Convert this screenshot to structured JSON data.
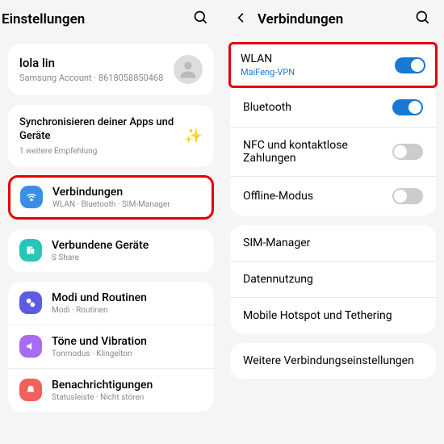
{
  "left": {
    "title": "Einstellungen",
    "profile": {
      "name": "lola lin",
      "sub": "Samsung Account · 8618058850468"
    },
    "sync": {
      "title": "Synchronisieren deiner Apps und Geräte",
      "sub": "1 weitere Empfehlung"
    },
    "items": [
      {
        "label": "Verbindungen",
        "desc": "WLAN · Bluetooth · SIM-Manager",
        "color": "#3a8ee6"
      },
      {
        "label": "Verbundene Geräte",
        "desc": "S Share",
        "color": "#29c5b8"
      },
      {
        "label": "Modi und Routinen",
        "desc": "Modi · Routinen",
        "color": "#5c5ce0"
      },
      {
        "label": "Töne und Vibration",
        "desc": "Tonmodus · Klingelton",
        "color": "#a76cf0"
      },
      {
        "label": "Benachrichtigungen",
        "desc": "Statusleiste · Nicht stören",
        "color": "#f0615c"
      }
    ]
  },
  "right": {
    "title": "Verbindungen",
    "group1": [
      {
        "label": "WLAN",
        "sub": "MaiFeng-VPN",
        "toggle": "on"
      },
      {
        "label": "Bluetooth",
        "toggle": "on"
      },
      {
        "label": "NFC und kontaktlose Zahlungen",
        "toggle": "off"
      },
      {
        "label": "Offline-Modus",
        "toggle": "off"
      }
    ],
    "group2": [
      {
        "label": "SIM-Manager"
      },
      {
        "label": "Datennutzung"
      },
      {
        "label": "Mobile Hotspot und Tethering"
      }
    ],
    "group3": [
      {
        "label": "Weitere Verbindungseinstellungen"
      }
    ]
  }
}
